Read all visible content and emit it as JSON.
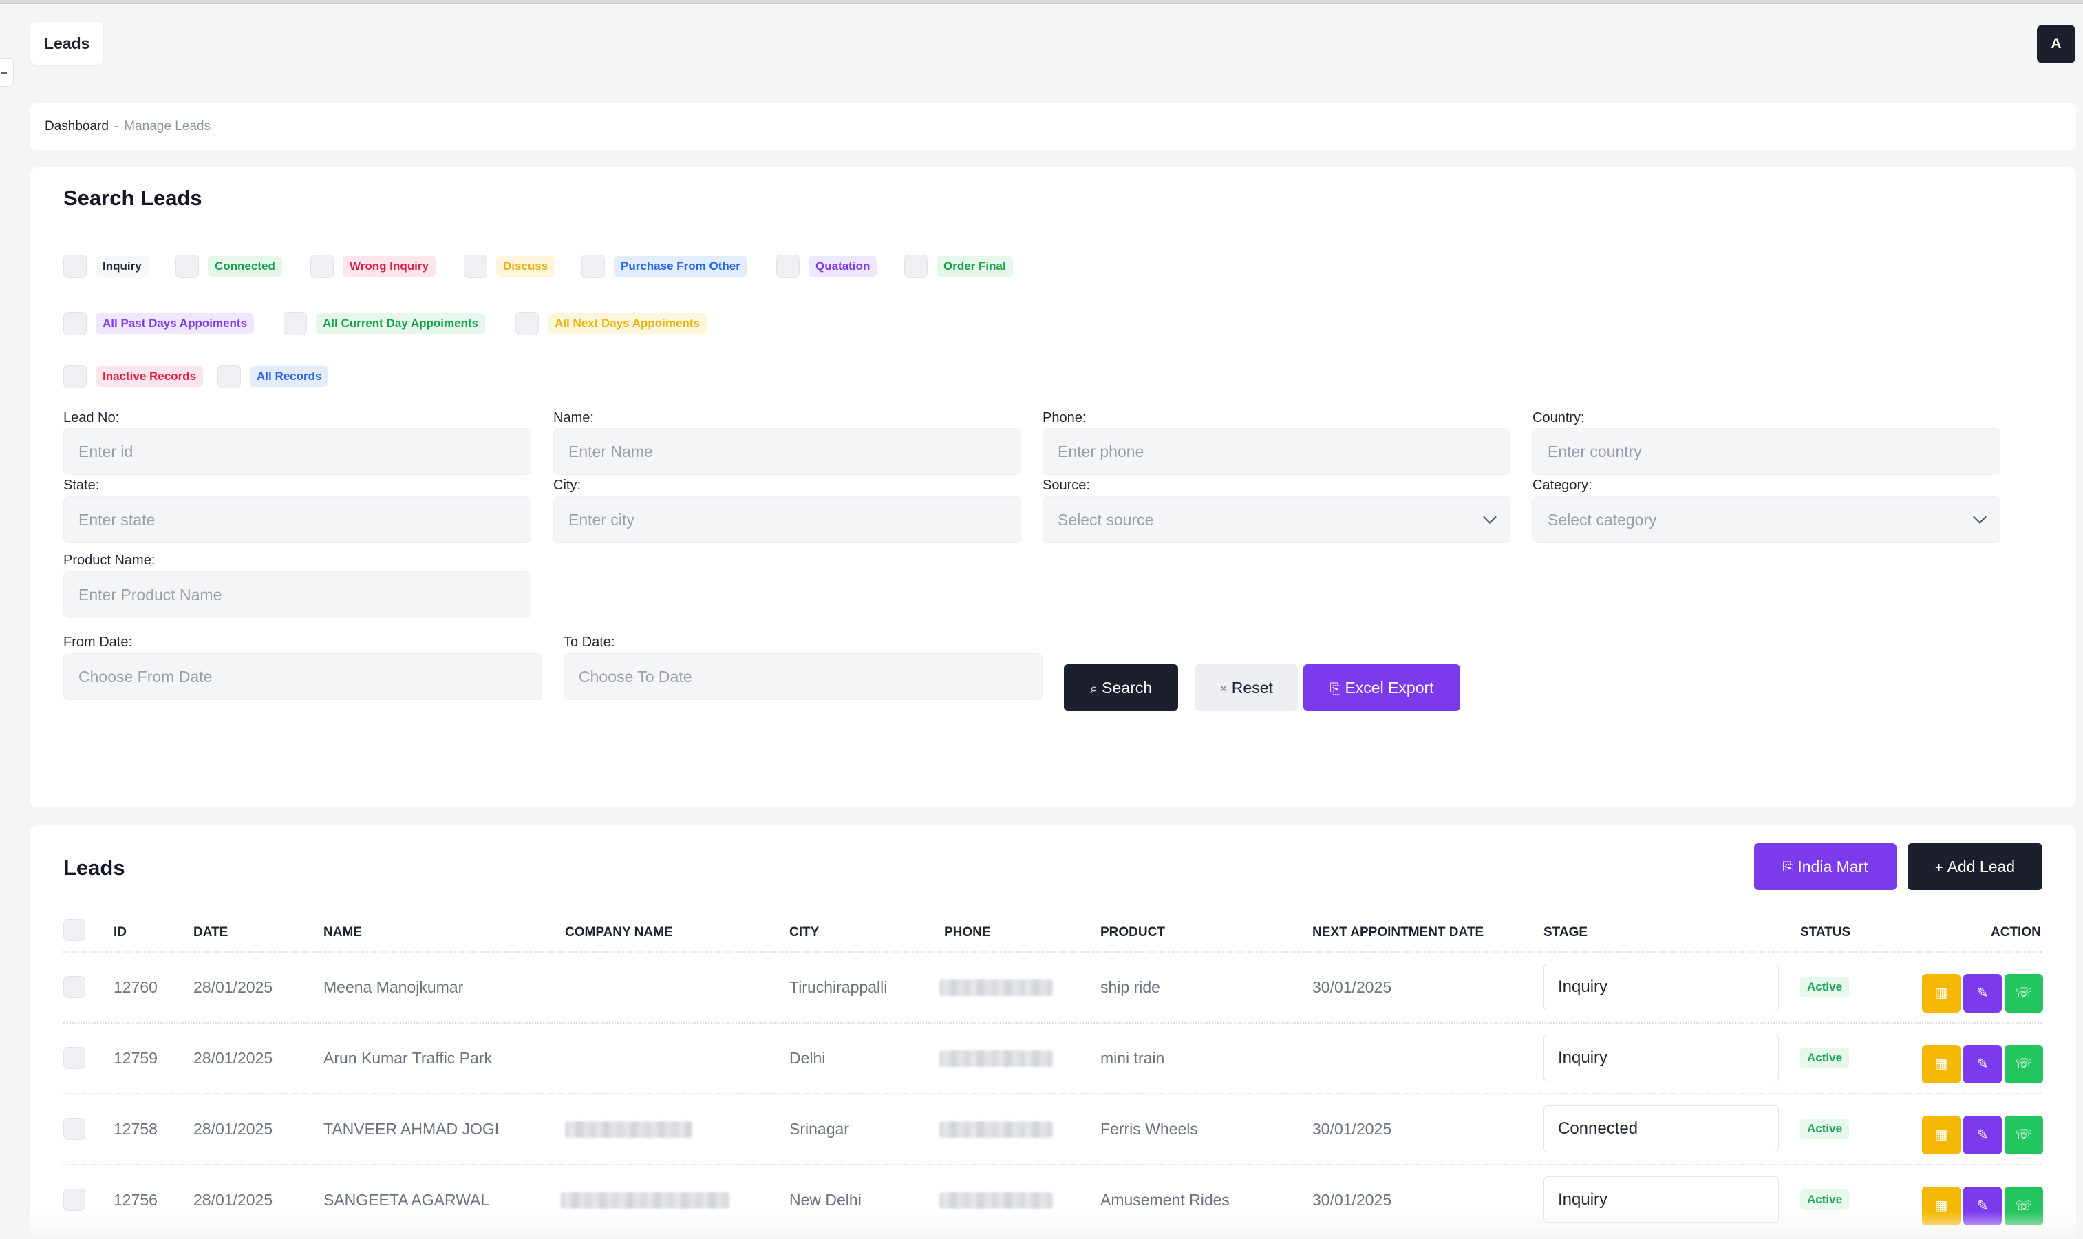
{
  "header": {
    "title": "Leads",
    "avatar_letter": "A"
  },
  "breadcrumb": {
    "root": "Dashboard",
    "separator": "-",
    "current": "Manage Leads"
  },
  "search": {
    "title": "Search Leads",
    "filters_row1": [
      {
        "label": "Inquiry",
        "color": "#1f2433",
        "bg": "#f2f3f6"
      },
      {
        "label": "Connected",
        "color": "#16a34a",
        "bg": "#e4f7ea"
      },
      {
        "label": "Wrong Inquiry",
        "color": "#e11d48",
        "bg": "#fde6eb"
      },
      {
        "label": "Discuss",
        "color": "#eab308",
        "bg": "#fdf6dc"
      },
      {
        "label": "Purchase From Other",
        "color": "#2563eb",
        "bg": "#e3ecfb"
      },
      {
        "label": "Quatation",
        "color": "#7c3aed",
        "bg": "#efe7fd"
      },
      {
        "label": "Order Final",
        "color": "#16a34a",
        "bg": "#e4f7ea"
      }
    ],
    "filters_row2": [
      {
        "label": "All Past Days Appoiments",
        "color": "#7c3aed",
        "bg": "#efe7fd"
      },
      {
        "label": "All Current Day Appoiments",
        "color": "#16a34a",
        "bg": "#e4f7ea"
      },
      {
        "label": "All Next Days Appoiments",
        "color": "#eab308",
        "bg": "#fdf6dc"
      }
    ],
    "filters_row3": [
      {
        "label": "Inactive Records",
        "color": "#e11d48",
        "bg": "#fde6eb"
      },
      {
        "label": "All Records",
        "color": "#2563eb",
        "bg": "#e3ecfb"
      }
    ],
    "fields": {
      "lead_no": {
        "label": "Lead No:",
        "placeholder": "Enter id"
      },
      "name": {
        "label": "Name:",
        "placeholder": "Enter Name"
      },
      "phone": {
        "label": "Phone:",
        "placeholder": "Enter phone"
      },
      "country": {
        "label": "Country:",
        "placeholder": "Enter country"
      },
      "state": {
        "label": "State:",
        "placeholder": "Enter state"
      },
      "city": {
        "label": "City:",
        "placeholder": "Enter city"
      },
      "source": {
        "label": "Source:",
        "placeholder": "Select source"
      },
      "category": {
        "label": "Category:",
        "placeholder": "Select category"
      },
      "product_name": {
        "label": "Product Name:",
        "placeholder": "Enter Product Name"
      },
      "from_date": {
        "label": "From Date:",
        "placeholder": "Choose From Date"
      },
      "to_date": {
        "label": "To Date:",
        "placeholder": "Choose To Date"
      }
    },
    "buttons": {
      "search": "Search",
      "reset": "Reset",
      "excel_export": "Excel Export"
    }
  },
  "leads": {
    "title": "Leads",
    "buttons": {
      "india_mart": "India Mart",
      "add_lead": "Add Lead"
    },
    "columns": [
      "ID",
      "DATE",
      "NAME",
      "COMPANY NAME",
      "CITY",
      "PHONE",
      "PRODUCT",
      "NEXT APPOINTMENT DATE",
      "STAGE",
      "STATUS",
      "ACTION"
    ],
    "rows": [
      {
        "id": "12760",
        "date": "28/01/2025",
        "name": "Meena Manojkumar",
        "company": "",
        "city": "Tiruchirappalli",
        "product": "ship ride",
        "next_appointment": "30/01/2025",
        "stage": "Inquiry",
        "status": "Active"
      },
      {
        "id": "12759",
        "date": "28/01/2025",
        "name": "Arun Kumar Traffic Park",
        "company": "",
        "city": "Delhi",
        "product": "mini train",
        "next_appointment": "",
        "stage": "Inquiry",
        "status": "Active"
      },
      {
        "id": "12758",
        "date": "28/01/2025",
        "name": "TANVEER AHMAD JOGI",
        "company": "",
        "city": "Srinagar",
        "product": "Ferris Wheels",
        "next_appointment": "30/01/2025",
        "stage": "Connected",
        "status": "Active"
      },
      {
        "id": "12756",
        "date": "28/01/2025",
        "name": "SANGEETA AGARWAL",
        "company": "",
        "city": "New Delhi",
        "product": "Amusement Rides",
        "next_appointment": "30/01/2025",
        "stage": "Inquiry",
        "status": "Active"
      }
    ],
    "action_icons": [
      "calendar-icon",
      "edit-icon",
      "whatsapp-icon"
    ]
  }
}
